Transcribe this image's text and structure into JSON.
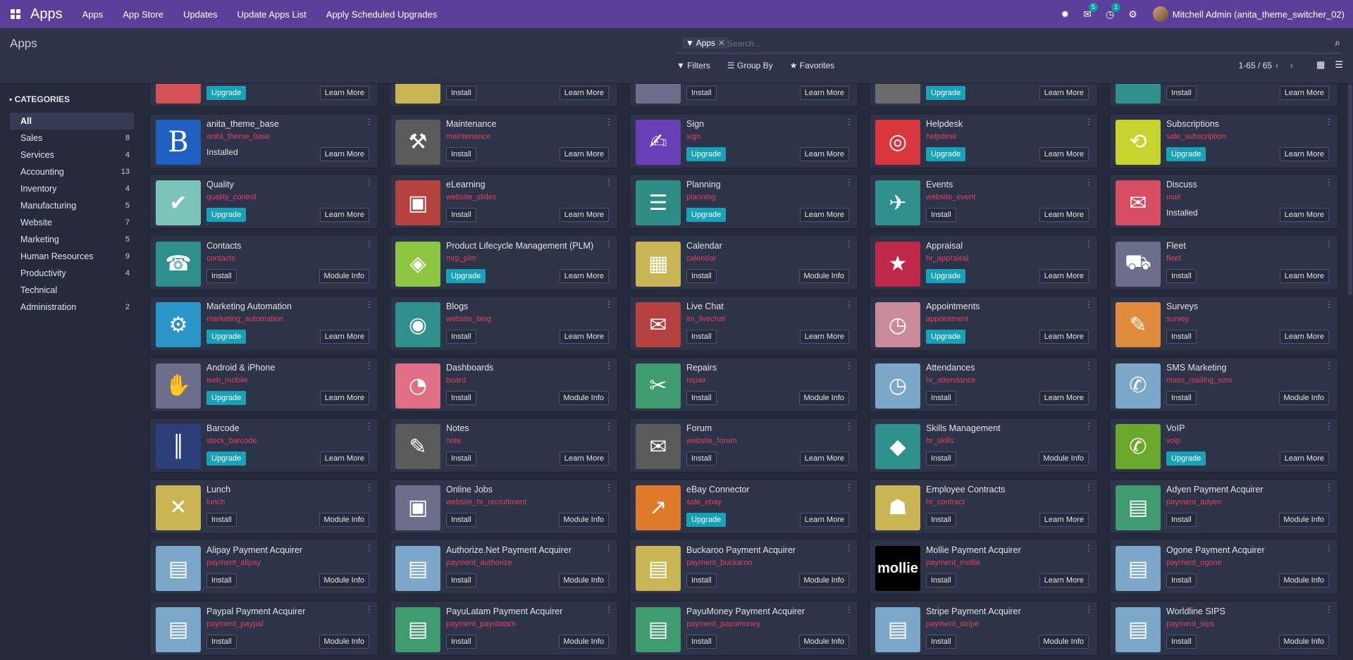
{
  "navbar": {
    "brand": "Apps",
    "menu": [
      "Apps",
      "App Store",
      "Updates",
      "Update Apps List",
      "Apply Scheduled Upgrades"
    ],
    "messages_count": "5",
    "activities_count": "1",
    "user": "Mitchell Admin (anita_theme_switcher_02)"
  },
  "control_panel": {
    "title": "Apps",
    "facet": "Apps",
    "search_placeholder": "Search...",
    "filters": "Filters",
    "group_by": "Group By",
    "favorites": "Favorites",
    "pager": "1-65 / 65"
  },
  "sidebar": {
    "header": "CATEGORIES",
    "items": [
      {
        "label": "All",
        "count": ""
      },
      {
        "label": "Sales",
        "count": "8"
      },
      {
        "label": "Services",
        "count": "4"
      },
      {
        "label": "Accounting",
        "count": "13"
      },
      {
        "label": "Inventory",
        "count": "4"
      },
      {
        "label": "Manufacturing",
        "count": "5"
      },
      {
        "label": "Website",
        "count": "7"
      },
      {
        "label": "Marketing",
        "count": "5"
      },
      {
        "label": "Human Resources",
        "count": "9"
      },
      {
        "label": "Productivity",
        "count": "4"
      },
      {
        "label": "Technical",
        "count": ""
      },
      {
        "label": "Administration",
        "count": "2"
      }
    ]
  },
  "apps": [
    {
      "name": "",
      "tech": "",
      "action": "Upgrade",
      "info": "Learn More",
      "color": "#d44f56",
      "glyph": ""
    },
    {
      "name": "",
      "tech": "",
      "action": "Install",
      "info": "Learn More",
      "color": "#c9b553",
      "glyph": ""
    },
    {
      "name": "",
      "tech": "",
      "action": "Install",
      "info": "Learn More",
      "color": "#6c6f8c",
      "glyph": ""
    },
    {
      "name": "",
      "tech": "",
      "action": "Upgrade",
      "info": "Learn More",
      "color": "#6b6b6b",
      "glyph": ""
    },
    {
      "name": "",
      "tech": "",
      "action": "Install",
      "info": "Learn More",
      "color": "#2f8f8a",
      "glyph": ""
    },
    {
      "name": "anita_theme_base",
      "tech": "anita_theme_base",
      "action": "Installed",
      "info": "Learn More",
      "color": "#1f5fbf",
      "glyph": "B"
    },
    {
      "name": "Maintenance",
      "tech": "maintenance",
      "action": "Install",
      "info": "Learn More",
      "color": "#5a5a5a",
      "glyph": "⚒"
    },
    {
      "name": "Sign",
      "tech": "sign",
      "action": "Upgrade",
      "info": "Learn More",
      "color": "#6a3fb5",
      "glyph": "✍"
    },
    {
      "name": "Helpdesk",
      "tech": "helpdesk",
      "action": "Upgrade",
      "info": "Learn More",
      "color": "#d9363e",
      "glyph": "◎"
    },
    {
      "name": "Subscriptions",
      "tech": "sale_subscription",
      "action": "Upgrade",
      "info": "Learn More",
      "color": "#c8d42e",
      "glyph": "⟲"
    },
    {
      "name": "Quality",
      "tech": "quality_control",
      "action": "Upgrade",
      "info": "Learn More",
      "color": "#7cc3b8",
      "glyph": "✔"
    },
    {
      "name": "eLearning",
      "tech": "website_slides",
      "action": "Install",
      "info": "Learn More",
      "color": "#b5423f",
      "glyph": "▣"
    },
    {
      "name": "Planning",
      "tech": "planning",
      "action": "Upgrade",
      "info": "Learn More",
      "color": "#2d8d86",
      "glyph": "☰"
    },
    {
      "name": "Events",
      "tech": "website_event",
      "action": "Install",
      "info": "Learn More",
      "color": "#2f8f8a",
      "glyph": "✈"
    },
    {
      "name": "Discuss",
      "tech": "mail",
      "action": "Installed",
      "info": "Learn More",
      "color": "#d94d63",
      "glyph": "✉"
    },
    {
      "name": "Contacts",
      "tech": "contacts",
      "action": "Install",
      "info": "Module Info",
      "color": "#2f8f8a",
      "glyph": "☎"
    },
    {
      "name": "Product Lifecycle Management (PLM)",
      "tech": "mrp_plm",
      "action": "Upgrade",
      "info": "Learn More",
      "color": "#8dc63f",
      "glyph": "◈"
    },
    {
      "name": "Calendar",
      "tech": "calendar",
      "action": "Install",
      "info": "Module Info",
      "color": "#c9b553",
      "glyph": "▦"
    },
    {
      "name": "Appraisal",
      "tech": "hr_appraisal",
      "action": "Upgrade",
      "info": "Learn More",
      "color": "#c0284a",
      "glyph": "★"
    },
    {
      "name": "Fleet",
      "tech": "fleet",
      "action": "Install",
      "info": "Learn More",
      "color": "#6c6f8c",
      "glyph": "⛟"
    },
    {
      "name": "Marketing Automation",
      "tech": "marketing_automation",
      "action": "Upgrade",
      "info": "Learn More",
      "color": "#2a95c9",
      "glyph": "⚙"
    },
    {
      "name": "Blogs",
      "tech": "website_blog",
      "action": "Install",
      "info": "Learn More",
      "color": "#2f8f8a",
      "glyph": "◉"
    },
    {
      "name": "Live Chat",
      "tech": "im_livechat",
      "action": "Install",
      "info": "Learn More",
      "color": "#b5423f",
      "glyph": "✉"
    },
    {
      "name": "Appointments",
      "tech": "appointment",
      "action": "Upgrade",
      "info": "Learn More",
      "color": "#c98a9a",
      "glyph": "◷"
    },
    {
      "name": "Surveys",
      "tech": "survey",
      "action": "Install",
      "info": "Learn More",
      "color": "#e08a3c",
      "glyph": "✎"
    },
    {
      "name": "Android & iPhone",
      "tech": "web_mobile",
      "action": "Upgrade",
      "info": "Learn More",
      "color": "#6c6f8c",
      "glyph": "✋"
    },
    {
      "name": "Dashboards",
      "tech": "board",
      "action": "Install",
      "info": "Module Info",
      "color": "#e06f86",
      "glyph": "◔"
    },
    {
      "name": "Repairs",
      "tech": "repair",
      "action": "Install",
      "info": "Module Info",
      "color": "#3f9c6e",
      "glyph": "✂"
    },
    {
      "name": "Attendances",
      "tech": "hr_attendance",
      "action": "Install",
      "info": "Learn More",
      "color": "#7ba7c9",
      "glyph": "◷"
    },
    {
      "name": "SMS Marketing",
      "tech": "mass_mailing_sms",
      "action": "Install",
      "info": "Module Info",
      "color": "#7ba7c9",
      "glyph": "✆"
    },
    {
      "name": "Barcode",
      "tech": "stock_barcode",
      "action": "Upgrade",
      "info": "Learn More",
      "color": "#2c3e7a",
      "glyph": "║"
    },
    {
      "name": "Notes",
      "tech": "note",
      "action": "Install",
      "info": "Learn More",
      "color": "#5a5a5a",
      "glyph": "✎"
    },
    {
      "name": "Forum",
      "tech": "website_forum",
      "action": "Install",
      "info": "Learn More",
      "color": "#5a5a5a",
      "glyph": "✉"
    },
    {
      "name": "Skills Management",
      "tech": "hr_skills",
      "action": "Install",
      "info": "Module Info",
      "color": "#2f8f8a",
      "glyph": "◆"
    },
    {
      "name": "VoIP",
      "tech": "voip",
      "action": "Upgrade",
      "info": "Learn More",
      "color": "#6aa82c",
      "glyph": "✆"
    },
    {
      "name": "Lunch",
      "tech": "lunch",
      "action": "Install",
      "info": "Module Info",
      "color": "#c9b553",
      "glyph": "✕"
    },
    {
      "name": "Online Jobs",
      "tech": "website_hr_recruitment",
      "action": "Install",
      "info": "Module Info",
      "color": "#6c6f8c",
      "glyph": "▣"
    },
    {
      "name": "eBay Connector",
      "tech": "sale_ebay",
      "action": "Upgrade",
      "info": "Learn More",
      "color": "#e07a2b",
      "glyph": "↗"
    },
    {
      "name": "Employee Contracts",
      "tech": "hr_contract",
      "action": "Install",
      "info": "Learn More",
      "color": "#c9b553",
      "glyph": "☗"
    },
    {
      "name": "Adyen Payment Acquirer",
      "tech": "payment_adyen",
      "action": "Install",
      "info": "Module Info",
      "color": "#3f9c6e",
      "glyph": "▤"
    },
    {
      "name": "Alipay Payment Acquirer",
      "tech": "payment_alipay",
      "action": "Install",
      "info": "Module Info",
      "color": "#7ba7c9",
      "glyph": "▤"
    },
    {
      "name": "Authorize.Net Payment Acquirer",
      "tech": "payment_authorize",
      "action": "Install",
      "info": "Module Info",
      "color": "#7ba7c9",
      "glyph": "▤"
    },
    {
      "name": "Buckaroo Payment Acquirer",
      "tech": "payment_buckaroo",
      "action": "Install",
      "info": "Module Info",
      "color": "#c9b553",
      "glyph": "▤"
    },
    {
      "name": "Mollie Payment Acquirer",
      "tech": "payment_mollie",
      "action": "Install",
      "info": "Learn More",
      "color": "#000000",
      "glyph": "mollie"
    },
    {
      "name": "Ogone Payment Acquirer",
      "tech": "payment_ogone",
      "action": "Install",
      "info": "Module Info",
      "color": "#7ba7c9",
      "glyph": "▤"
    },
    {
      "name": "Paypal Payment Acquirer",
      "tech": "payment_paypal",
      "action": "Install",
      "info": "Module Info",
      "color": "#7ba7c9",
      "glyph": "▤"
    },
    {
      "name": "PayuLatam Payment Acquirer",
      "tech": "payment_payulatam",
      "action": "Install",
      "info": "Module Info",
      "color": "#3f9c6e",
      "glyph": "▤"
    },
    {
      "name": "PayuMoney Payment Acquirer",
      "tech": "payment_payumoney",
      "action": "Install",
      "info": "Module Info",
      "color": "#3f9c6e",
      "glyph": "▤"
    },
    {
      "name": "Stripe Payment Acquirer",
      "tech": "payment_stripe",
      "action": "Install",
      "info": "Module Info",
      "color": "#7ba7c9",
      "glyph": "▤"
    },
    {
      "name": "Worldline SIPS",
      "tech": "payment_sips",
      "action": "Install",
      "info": "Module Info",
      "color": "#7ba7c9",
      "glyph": "▤"
    }
  ]
}
